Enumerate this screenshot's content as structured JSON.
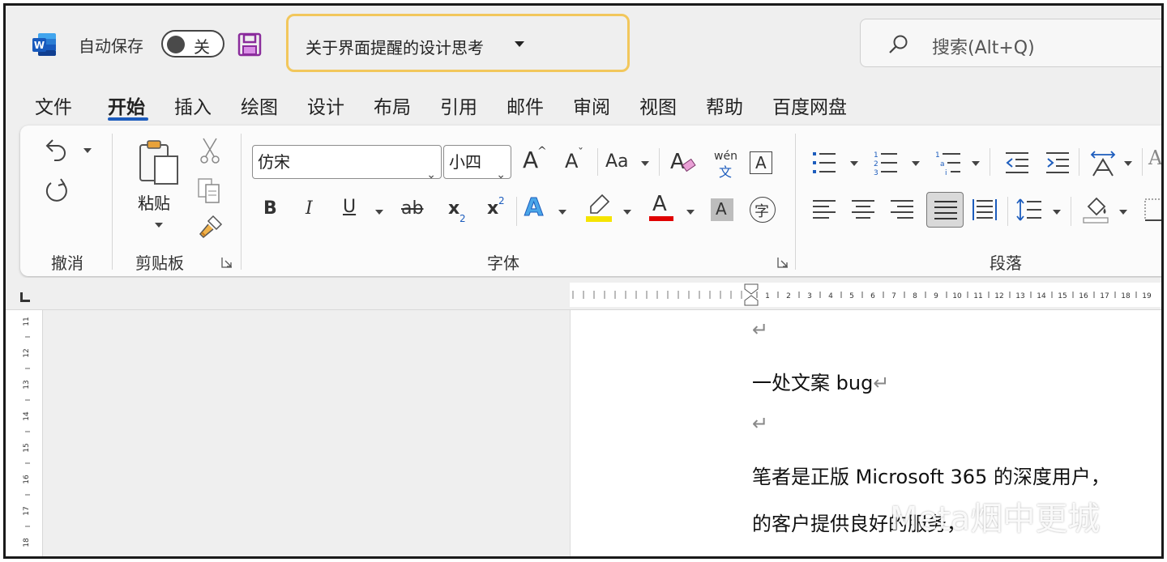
{
  "title_bar": {
    "app_icon": "word-icon",
    "autosave_label": "自动保存",
    "autosave_state": "关",
    "save_icon": "save-icon",
    "document_title": "关于界面提醒的设计思考",
    "search_placeholder": "搜索(Alt+Q)"
  },
  "tabs": [
    "文件",
    "开始",
    "插入",
    "绘图",
    "设计",
    "布局",
    "引用",
    "邮件",
    "审阅",
    "视图",
    "帮助",
    "百度网盘"
  ],
  "active_tab": "开始",
  "ribbon": {
    "undo_group": "撤消",
    "clipboard_group": "剪贴板",
    "paste_label": "粘贴",
    "font_group": "字体",
    "paragraph_group": "段落",
    "font_name": "仿宋",
    "font_size": "小四",
    "bold": "B",
    "italic": "I",
    "underline": "U",
    "strikethrough": "ab",
    "subscript": "x",
    "superscript": "x",
    "grow_font": "A",
    "shrink_font": "A",
    "change_case": "Aa",
    "phonetic_top": "wén",
    "phonetic_bottom": "文",
    "text_effects": "A",
    "font_color": "A",
    "char_shading": "A",
    "enclose_char": "字",
    "border_char": "A",
    "clear_format": "A",
    "highlight_color": "#f5e400",
    "font_color_swatch": "#e00000",
    "accent_color": "#1c5cbd"
  },
  "ruler_numbers": [
    "1",
    "2",
    "3",
    "4",
    "5",
    "6",
    "7",
    "8",
    "9",
    "10",
    "11",
    "12",
    "13",
    "14",
    "15",
    "16",
    "17",
    "18",
    "19"
  ],
  "vruler_numbers": [
    "11",
    "12",
    "13",
    "14",
    "15",
    "16",
    "17",
    "18"
  ],
  "document": {
    "p1": "↵",
    "p2_a": "一处文案 ",
    "p2_b": "bug",
    "p2_mark": "↵",
    "p3": "↵",
    "p4_a": "笔者是正版 ",
    "p4_b": "Microsoft 365",
    "p4_c": " 的深度用户，",
    "p5": "的客户提供良好的服务，"
  },
  "watermark": "Meta烟中更城"
}
